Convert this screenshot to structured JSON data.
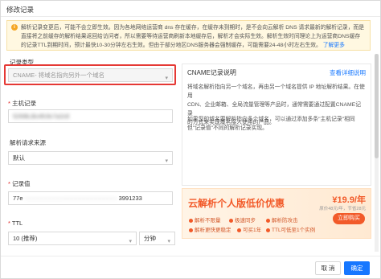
{
  "dialog": {
    "title": "修改记录"
  },
  "notice": {
    "icon": "info-icon",
    "line1": "解析记录变更后，可能不会立即生效。因为各地网络运营商 dns 存在缓存，在缓存未到期时，是不会向云解析 DNS 请求最新的解析记录，而是",
    "line2": "直接将之前缓存的解析结果返回给访问者，所以需要等待运营商刷新本地缓存后，解析才会实际生效。解析生效时间理论上为运营商DNS缓存",
    "line3": "的记录TTL到期时间，预计最快10-30分钟左右生效。但由于部分地区DNS服务器会强制缓存，可能需要24-48小时左右生效。",
    "link": "了解更多"
  },
  "form": {
    "record_type": {
      "label": "记录类型",
      "value": "CNAME- 将域名指向另外一个域名"
    },
    "host": {
      "label": "主机记录",
      "value": "5269b,Bc4fc9c7a2c8"
    },
    "line": {
      "label": "解析请求来源",
      "value": "默认"
    },
    "value": {
      "label": "记录值",
      "prefix": "77e",
      "suffix": "3991233"
    },
    "ttl": {
      "label": "TTL",
      "value": "10 (推荐)",
      "unit": "分钟"
    }
  },
  "panel": {
    "title": "CNAME记录说明",
    "link": "查看详细说明",
    "para1_l1": "将域名解析指向另一个域名，再由另一个域名提供 IP 地址解析结果。在使用",
    "para1_l2": "CDN、企业邮箱、全局流量管理等产品时，通常需要通过配置CNAME记录",
    "para1_l3": "的方式来实现域名接入使用的产品。",
    "para2_l1": "如果您的域名要解析指向多个域名，可以通过添加多条\"主机记录\"相同",
    "para2_l2": "但\"记录值\"不同的解析记录实现。"
  },
  "promo": {
    "title": "云解析个人版低价优惠",
    "feat1": "解析不限量",
    "feat2": "极速同步",
    "feat3": "解析防攻击",
    "feat4": "解析更快更稳定",
    "feat5": "可买1年",
    "feat6": "TTL可低至1个实例",
    "price": "¥19.9/年",
    "price_sub": "原价48元/年，节省28元",
    "button": "立即购买"
  },
  "footer": {
    "cancel": "取 消",
    "ok": "确定"
  },
  "colors": {
    "primary": "#1677ff",
    "promo": "#f25a29",
    "highlight": "#e53935",
    "notice_bg": "#fff8e1"
  }
}
